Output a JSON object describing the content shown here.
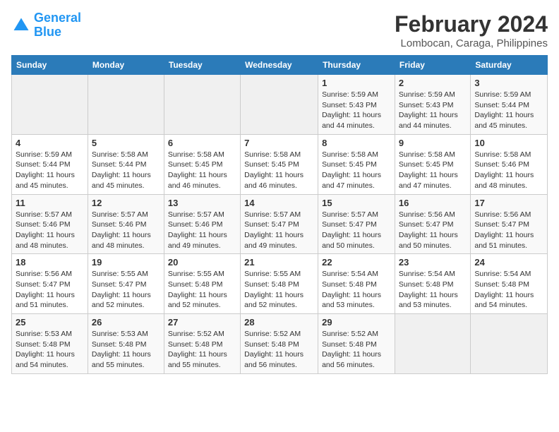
{
  "logo": {
    "line1": "General",
    "line2": "Blue"
  },
  "title": "February 2024",
  "location": "Lombocan, Caraga, Philippines",
  "days_of_week": [
    "Sunday",
    "Monday",
    "Tuesday",
    "Wednesday",
    "Thursday",
    "Friday",
    "Saturday"
  ],
  "weeks": [
    [
      {
        "day": "",
        "info": ""
      },
      {
        "day": "",
        "info": ""
      },
      {
        "day": "",
        "info": ""
      },
      {
        "day": "",
        "info": ""
      },
      {
        "day": "1",
        "info": "Sunrise: 5:59 AM\nSunset: 5:43 PM\nDaylight: 11 hours\nand 44 minutes."
      },
      {
        "day": "2",
        "info": "Sunrise: 5:59 AM\nSunset: 5:43 PM\nDaylight: 11 hours\nand 44 minutes."
      },
      {
        "day": "3",
        "info": "Sunrise: 5:59 AM\nSunset: 5:44 PM\nDaylight: 11 hours\nand 45 minutes."
      }
    ],
    [
      {
        "day": "4",
        "info": "Sunrise: 5:59 AM\nSunset: 5:44 PM\nDaylight: 11 hours\nand 45 minutes."
      },
      {
        "day": "5",
        "info": "Sunrise: 5:58 AM\nSunset: 5:44 PM\nDaylight: 11 hours\nand 45 minutes."
      },
      {
        "day": "6",
        "info": "Sunrise: 5:58 AM\nSunset: 5:45 PM\nDaylight: 11 hours\nand 46 minutes."
      },
      {
        "day": "7",
        "info": "Sunrise: 5:58 AM\nSunset: 5:45 PM\nDaylight: 11 hours\nand 46 minutes."
      },
      {
        "day": "8",
        "info": "Sunrise: 5:58 AM\nSunset: 5:45 PM\nDaylight: 11 hours\nand 47 minutes."
      },
      {
        "day": "9",
        "info": "Sunrise: 5:58 AM\nSunset: 5:45 PM\nDaylight: 11 hours\nand 47 minutes."
      },
      {
        "day": "10",
        "info": "Sunrise: 5:58 AM\nSunset: 5:46 PM\nDaylight: 11 hours\nand 48 minutes."
      }
    ],
    [
      {
        "day": "11",
        "info": "Sunrise: 5:57 AM\nSunset: 5:46 PM\nDaylight: 11 hours\nand 48 minutes."
      },
      {
        "day": "12",
        "info": "Sunrise: 5:57 AM\nSunset: 5:46 PM\nDaylight: 11 hours\nand 48 minutes."
      },
      {
        "day": "13",
        "info": "Sunrise: 5:57 AM\nSunset: 5:46 PM\nDaylight: 11 hours\nand 49 minutes."
      },
      {
        "day": "14",
        "info": "Sunrise: 5:57 AM\nSunset: 5:47 PM\nDaylight: 11 hours\nand 49 minutes."
      },
      {
        "day": "15",
        "info": "Sunrise: 5:57 AM\nSunset: 5:47 PM\nDaylight: 11 hours\nand 50 minutes."
      },
      {
        "day": "16",
        "info": "Sunrise: 5:56 AM\nSunset: 5:47 PM\nDaylight: 11 hours\nand 50 minutes."
      },
      {
        "day": "17",
        "info": "Sunrise: 5:56 AM\nSunset: 5:47 PM\nDaylight: 11 hours\nand 51 minutes."
      }
    ],
    [
      {
        "day": "18",
        "info": "Sunrise: 5:56 AM\nSunset: 5:47 PM\nDaylight: 11 hours\nand 51 minutes."
      },
      {
        "day": "19",
        "info": "Sunrise: 5:55 AM\nSunset: 5:47 PM\nDaylight: 11 hours\nand 52 minutes."
      },
      {
        "day": "20",
        "info": "Sunrise: 5:55 AM\nSunset: 5:48 PM\nDaylight: 11 hours\nand 52 minutes."
      },
      {
        "day": "21",
        "info": "Sunrise: 5:55 AM\nSunset: 5:48 PM\nDaylight: 11 hours\nand 52 minutes."
      },
      {
        "day": "22",
        "info": "Sunrise: 5:54 AM\nSunset: 5:48 PM\nDaylight: 11 hours\nand 53 minutes."
      },
      {
        "day": "23",
        "info": "Sunrise: 5:54 AM\nSunset: 5:48 PM\nDaylight: 11 hours\nand 53 minutes."
      },
      {
        "day": "24",
        "info": "Sunrise: 5:54 AM\nSunset: 5:48 PM\nDaylight: 11 hours\nand 54 minutes."
      }
    ],
    [
      {
        "day": "25",
        "info": "Sunrise: 5:53 AM\nSunset: 5:48 PM\nDaylight: 11 hours\nand 54 minutes."
      },
      {
        "day": "26",
        "info": "Sunrise: 5:53 AM\nSunset: 5:48 PM\nDaylight: 11 hours\nand 55 minutes."
      },
      {
        "day": "27",
        "info": "Sunrise: 5:52 AM\nSunset: 5:48 PM\nDaylight: 11 hours\nand 55 minutes."
      },
      {
        "day": "28",
        "info": "Sunrise: 5:52 AM\nSunset: 5:48 PM\nDaylight: 11 hours\nand 56 minutes."
      },
      {
        "day": "29",
        "info": "Sunrise: 5:52 AM\nSunset: 5:48 PM\nDaylight: 11 hours\nand 56 minutes."
      },
      {
        "day": "",
        "info": ""
      },
      {
        "day": "",
        "info": ""
      }
    ]
  ]
}
